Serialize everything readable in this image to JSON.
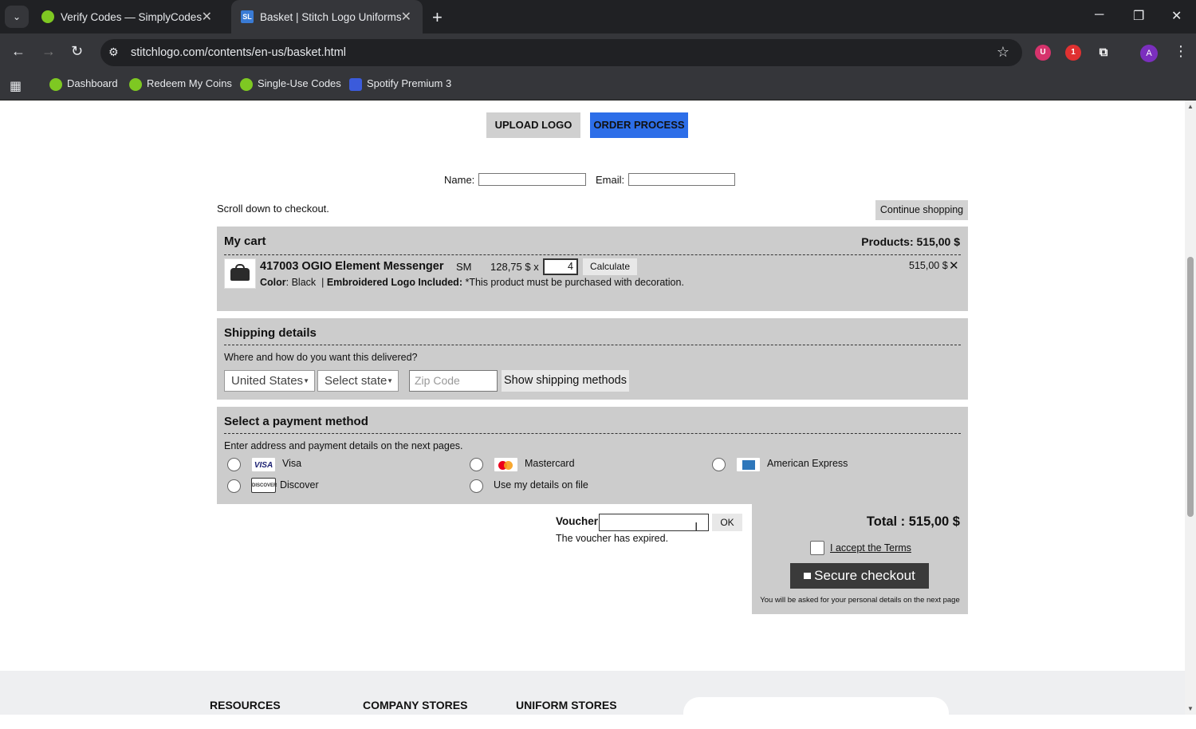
{
  "browser": {
    "tabs": [
      {
        "title": "Verify Codes — SimplyCodes",
        "active": false
      },
      {
        "title": "Basket | Stitch Logo Uniforms",
        "active": true
      }
    ],
    "url": "stitchlogo.com/contents/en-us/basket.html",
    "bookmarks": [
      "Dashboard",
      "Redeem My Coins",
      "Single-Use Codes",
      "Spotify Premium 3"
    ],
    "extension_badge": "1",
    "avatar_letter": "A",
    "fav_sl": "SL"
  },
  "top_buttons": {
    "upload_logo": "UPLOAD LOGO",
    "order_process": "ORDER PROCESS"
  },
  "contact": {
    "name_label": "Name:",
    "email_label": "Email:"
  },
  "scroll_note": "Scroll down to checkout.",
  "continue_shopping": "Continue shopping",
  "cart": {
    "title": "My cart",
    "products_total": "Products: 515,00 $",
    "item": {
      "name": "417003 OGIO Element Messenger",
      "size": "SM",
      "unit_price": "128,75 $ x",
      "quantity": "4",
      "calculate": "Calculate",
      "line_total": "515,00 $",
      "remove": "✕",
      "color_label": "Color",
      "color_value": ": Black",
      "separator": "|",
      "logo_label": "Embroidered Logo Included:",
      "logo_note": "*This product must be purchased with decoration."
    }
  },
  "shipping": {
    "title": "Shipping details",
    "subtitle": "Where and how do you want this delivered?",
    "country": "United States",
    "state": "Select state",
    "zip_placeholder": "Zip Code",
    "show_methods": "Show shipping methods"
  },
  "payment": {
    "title": "Select a payment method",
    "subtitle": "Enter address and payment details on the next pages.",
    "methods": [
      "Visa",
      "Mastercard",
      "American Express",
      "Discover",
      "Use my details on file"
    ],
    "visa_logo": "VISA",
    "discover_logo": "DISCOVER"
  },
  "voucher": {
    "label": "Voucher",
    "ok": "OK",
    "message": "The voucher has expired."
  },
  "checkout": {
    "total": "Total :  515,00 $",
    "terms": "I accept the Terms",
    "secure_button": "Secure checkout",
    "note": "You will be asked for your personal details on the next page"
  },
  "footer": {
    "columns": [
      "RESOURCES",
      "COMPANY STORES",
      "UNIFORM STORES"
    ]
  }
}
